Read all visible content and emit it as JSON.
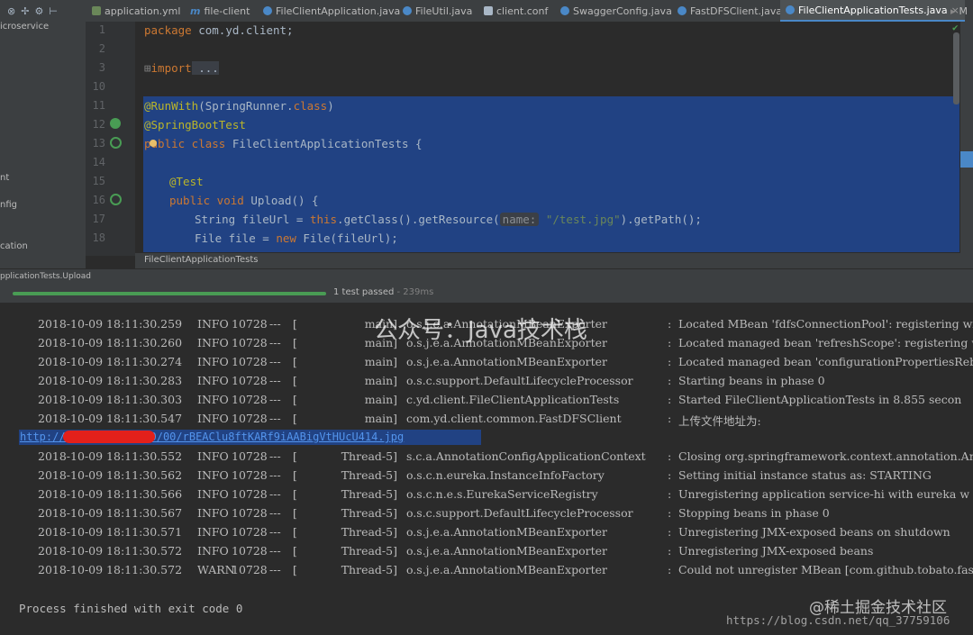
{
  "toolbar_icons": [
    "close-icon",
    "split-icon",
    "gear-icon",
    "pin-icon"
  ],
  "tabs": [
    {
      "label": "application.yml",
      "icon": "yaml-file-icon",
      "color": "#6a8759"
    },
    {
      "label": "file-client",
      "icon": "maven-icon",
      "color": "#4a88c7"
    },
    {
      "label": "FileClientApplication.java",
      "icon": "class-icon",
      "color": "#4a88c7"
    },
    {
      "label": "FileUtil.java",
      "icon": "class-icon",
      "color": "#4a88c7"
    },
    {
      "label": "client.conf",
      "icon": "text-file-icon",
      "color": "#a9b7c6"
    },
    {
      "label": "SwaggerConfig.java",
      "icon": "class-icon",
      "color": "#4a88c7"
    },
    {
      "label": "FastDFSClient.java",
      "icon": "class-icon",
      "color": "#4a88c7"
    },
    {
      "label": "FileClientApplicationTests.java",
      "icon": "class-icon",
      "color": "#4a88c7"
    },
    {
      "label": "M",
      "icon": "maven-icon",
      "color": "#4a88c7"
    }
  ],
  "left_panel": [
    "icroservice",
    "nt",
    "nfig",
    "cation"
  ],
  "editor": {
    "line_numbers": [
      "1",
      "2",
      "3",
      "10",
      "11",
      "12",
      "13",
      "14",
      "15",
      "16",
      "17",
      "18"
    ],
    "lines": [
      {
        "kw": "package",
        "rest": " com.yd.client;"
      },
      {
        "text": ""
      },
      {
        "kw": "import",
        "rest": " ..."
      },
      {
        "text": ""
      },
      {
        "an": "@RunWith",
        "rest": "(SpringRunner.",
        "kw2": "class",
        "rest2": ")"
      },
      {
        "an": "@SpringBootTest",
        "rest": ""
      },
      {
        "kw": "public class",
        "rest": " FileClientApplicationTests {"
      },
      {
        "text": ""
      },
      {
        "an": "@Test",
        "rest": ""
      },
      {
        "kw": "public void",
        "rest": " Upload() {"
      },
      {
        "pre": "String fileUrl = ",
        "kw": "this",
        "mid": ".getClass().getResource(",
        "hint": "name:",
        "str": " \"/test.jpg\"",
        "post": ").getPath();"
      },
      {
        "pre": "File file = ",
        "kw": "new",
        "mid": " File(fileUrl);"
      }
    ],
    "breadcrumb": "FileClientApplicationTests"
  },
  "run": {
    "config_label": "pplicationTests.Upload",
    "progress": 1.0,
    "status": "1 test passed",
    "duration": "- 239ms"
  },
  "console": {
    "rows": [
      {
        "ts": "2018-10-09 18:11:30.259",
        "lv": "INFO",
        "pid": "10728",
        "sep": "---",
        "th": "main]",
        "lg": "o.s.j.e.a.AnnotationMBeanExporter",
        "msg": "Located MBean 'fdfsConnectionPool': registering wi"
      },
      {
        "ts": "2018-10-09 18:11:30.260",
        "lv": "INFO",
        "pid": "10728",
        "sep": "---",
        "th": "main]",
        "lg": "o.s.j.e.a.AnnotationMBeanExporter",
        "msg": "Located managed bean 'refreshScope': registering w"
      },
      {
        "ts": "2018-10-09 18:11:30.274",
        "lv": "INFO",
        "pid": "10728",
        "sep": "---",
        "th": "main]",
        "lg": "o.s.j.e.a.AnnotationMBeanExporter",
        "msg": "Located managed bean 'configurationPropertiesRebin"
      },
      {
        "ts": "2018-10-09 18:11:30.283",
        "lv": "INFO",
        "pid": "10728",
        "sep": "---",
        "th": "main]",
        "lg": "o.s.c.support.DefaultLifecycleProcessor",
        "msg": "Starting beans in phase 0"
      },
      {
        "ts": "2018-10-09 18:11:30.303",
        "lv": "INFO",
        "pid": "10728",
        "sep": "---",
        "th": "main]",
        "lg": "c.yd.client.FileClientApplicationTests",
        "msg": "Started FileClientApplicationTests in 8.855 secon"
      },
      {
        "ts": "2018-10-09 18:11:30.547",
        "lv": "INFO",
        "pid": "10728",
        "sep": "---",
        "th": "main]",
        "lg": "com.yd.client.common.FastDFSClient",
        "msg": "上传文件地址为:"
      },
      {
        "url": "http://                group1/M00/00/00/rBEAClu8ftKARf9iAABigVtHUcU414.jpg"
      },
      {
        "ts": "2018-10-09 18:11:30.552",
        "lv": "INFO",
        "pid": "10728",
        "sep": "---",
        "th": "Thread-5]",
        "lg": "s.c.a.AnnotationConfigApplicationContext",
        "msg": "Closing org.springframework.context.annotation.Ann"
      },
      {
        "ts": "2018-10-09 18:11:30.562",
        "lv": "INFO",
        "pid": "10728",
        "sep": "---",
        "th": "Thread-5]",
        "lg": "o.s.c.n.eureka.InstanceInfoFactory",
        "msg": "Setting initial instance status as: STARTING"
      },
      {
        "ts": "2018-10-09 18:11:30.566",
        "lv": "INFO",
        "pid": "10728",
        "sep": "---",
        "th": "Thread-5]",
        "lg": "o.s.c.n.e.s.EurekaServiceRegistry",
        "msg": "Unregistering application service-hi with eureka w"
      },
      {
        "ts": "2018-10-09 18:11:30.567",
        "lv": "INFO",
        "pid": "10728",
        "sep": "---",
        "th": "Thread-5]",
        "lg": "o.s.c.support.DefaultLifecycleProcessor",
        "msg": "Stopping beans in phase 0"
      },
      {
        "ts": "2018-10-09 18:11:30.571",
        "lv": "INFO",
        "pid": "10728",
        "sep": "---",
        "th": "Thread-5]",
        "lg": "o.s.j.e.a.AnnotationMBeanExporter",
        "msg": "Unregistering JMX-exposed beans on shutdown"
      },
      {
        "ts": "2018-10-09 18:11:30.572",
        "lv": "INFO",
        "pid": "10728",
        "sep": "---",
        "th": "Thread-5]",
        "lg": "o.s.j.e.a.AnnotationMBeanExporter",
        "msg": "Unregistering JMX-exposed beans"
      },
      {
        "ts": "2018-10-09 18:11:30.572",
        "lv": "WARN",
        "pid": "10728",
        "sep": "---",
        "th": "Thread-5]",
        "lg": "o.s.j.e.a.AnnotationMBeanExporter",
        "msg": "Could not unregister MBean [com.github.tobato.fast"
      }
    ],
    "exit_message": "Process finished with exit code 0"
  },
  "watermarks": {
    "wechat": "公众号：Java技术栈",
    "juejin": "@稀土掘金技术社区",
    "csdn": "https://blog.csdn.net/qq_37759106"
  }
}
